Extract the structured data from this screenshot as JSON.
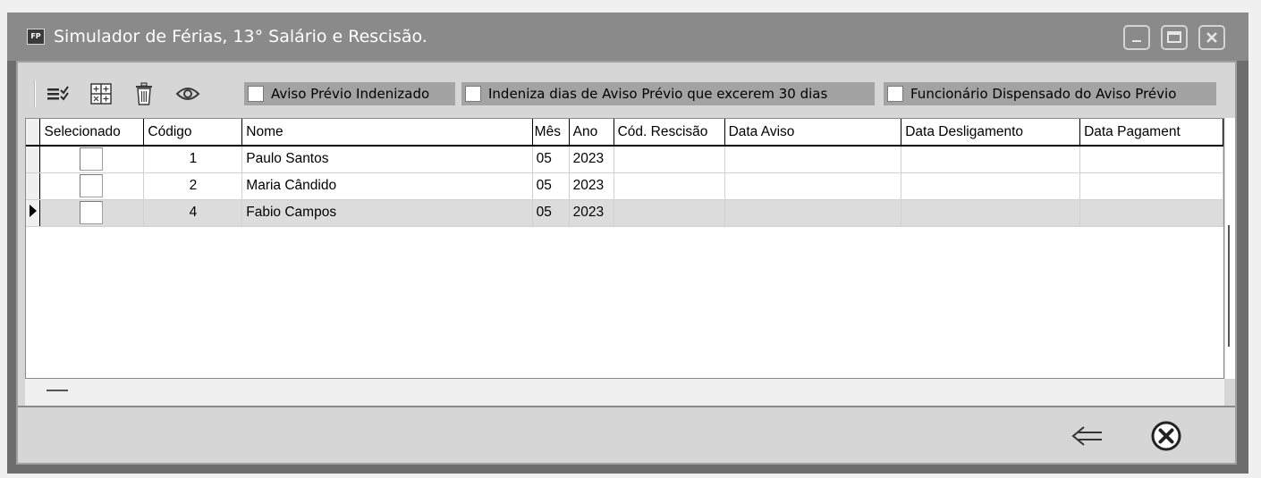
{
  "window": {
    "title": "Simulador de Férias,  13° Salário e Rescisão.",
    "icon_text": "FP",
    "icon": "fp-app-icon"
  },
  "toolbar": {
    "buttons": [
      {
        "icon": "select-all-icon"
      },
      {
        "icon": "grid-add-icon"
      },
      {
        "icon": "trash-icon"
      },
      {
        "icon": "eye-icon"
      }
    ],
    "checkboxes": [
      {
        "label": "Aviso Prévio Indenizado",
        "checked": false
      },
      {
        "label": "Indeniza dias de Aviso Prévio que excerem 30 dias",
        "checked": false
      },
      {
        "label": "Funcionário Dispensado do Aviso Prévio",
        "checked": false
      }
    ]
  },
  "grid": {
    "columns": [
      "Selecionado",
      "Código",
      "Nome",
      "Mês",
      "Ano",
      "Cód. Rescisão",
      "Data Aviso",
      "Data Desligamento",
      "Data Pagament"
    ],
    "rows": [
      {
        "selecionado": false,
        "codigo": "1",
        "nome": "Paulo Santos",
        "mes": "05",
        "ano": "2023",
        "cod_rescisao": "",
        "data_aviso": "",
        "data_desligamento": "",
        "data_pagamento": ""
      },
      {
        "selecionado": false,
        "codigo": "2",
        "nome": "Maria Cândido",
        "mes": "05",
        "ano": "2023",
        "cod_rescisao": "",
        "data_aviso": "",
        "data_desligamento": "",
        "data_pagamento": ""
      },
      {
        "selecionado": false,
        "codigo": "4",
        "nome": "Fabio Campos",
        "mes": "05",
        "ano": "2023",
        "cod_rescisao": "",
        "data_aviso": "",
        "data_desligamento": "",
        "data_pagamento": "",
        "current": true
      }
    ]
  },
  "footer": {
    "buttons": [
      {
        "icon": "back-arrow-icon"
      },
      {
        "icon": "close-circle-icon"
      }
    ]
  },
  "colors": {
    "titlebar": "#8a8a8a",
    "panel": "#d6d6d6",
    "checkbox_group_bg": "#a3a3a3",
    "active_row": "#dcdcdc"
  }
}
